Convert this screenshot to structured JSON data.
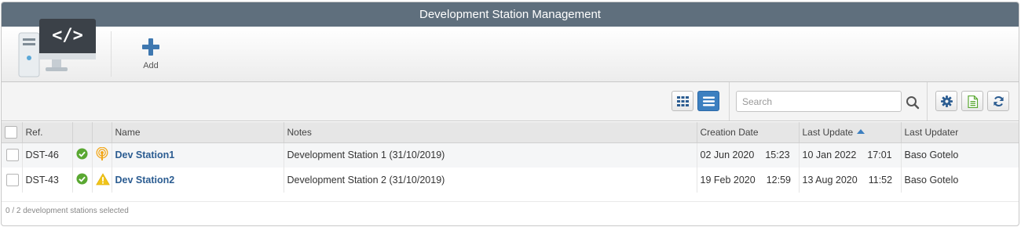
{
  "window": {
    "title": "Development Station Management"
  },
  "ribbon": {
    "add_label": "Add"
  },
  "toolbar": {
    "search_placeholder": "Search",
    "active_view": "list"
  },
  "table": {
    "columns": [
      "Ref.",
      "",
      "",
      "Name",
      "Notes",
      "Creation Date",
      "Last Update",
      "Last Updater"
    ],
    "sorted_by": "Last Update",
    "sort_direction": "ascending",
    "rows": [
      {
        "ref": "DST-46",
        "status_icon": "check-circle-icon",
        "alert_icon": "broadcast-icon",
        "name": "Dev Station1",
        "notes": "Development Station 1 (31/10/2019)",
        "creation_date": "02 Jun 2020",
        "creation_time": "15:23",
        "last_update_date": "10 Jan 2022",
        "last_update_time": "17:01",
        "last_updater": "Baso Gotelo"
      },
      {
        "ref": "DST-43",
        "status_icon": "check-circle-icon",
        "alert_icon": "warning-icon",
        "name": "Dev Station2",
        "notes": "Development Station 2 (31/10/2019)",
        "creation_date": "19 Feb 2020",
        "creation_time": "12:59",
        "last_update_date": "13 Aug 2020",
        "last_update_time": "11:52",
        "last_updater": "Baso Gotelo"
      }
    ]
  },
  "footer": {
    "selection_text": "0 / 2 development stations selected"
  },
  "colors": {
    "titlebar": "#5f6f7d",
    "accent": "#3c7fc0",
    "link": "#2b5c91",
    "ok": "#5aa832",
    "warning": "#f0c419",
    "broadcast": "#f2a81d"
  }
}
